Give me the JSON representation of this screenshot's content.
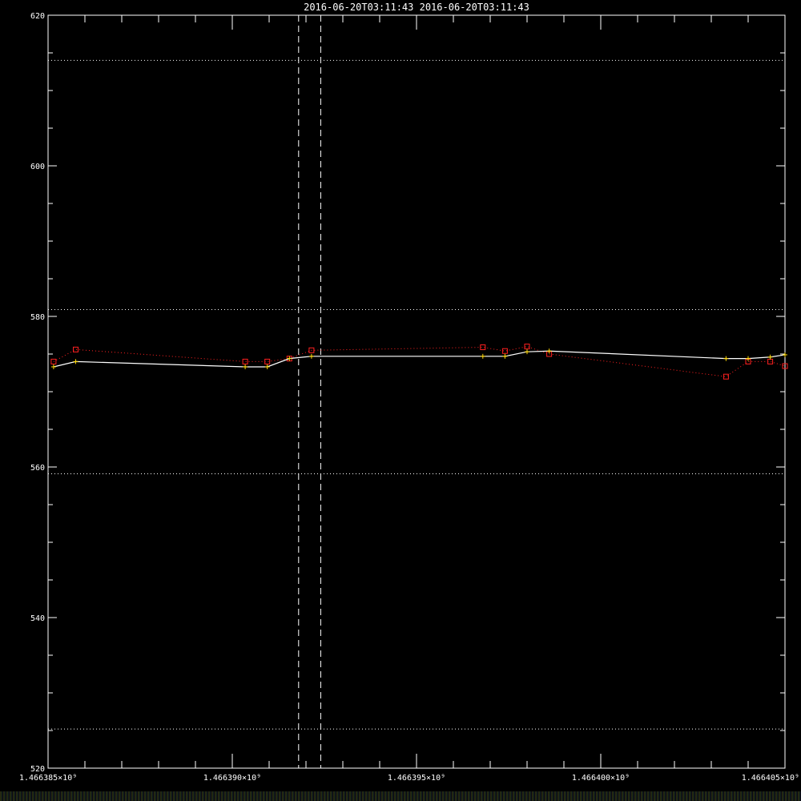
{
  "chart_data": {
    "type": "line",
    "title": "2016-06-20T03:11:43  2016-06-20T03:11:43",
    "xlabel": "",
    "ylabel": "",
    "xlim": [
      1466385000,
      1466405000
    ],
    "ylim": [
      520,
      620
    ],
    "x_ticks": [
      1466385000,
      1466390000,
      1466395000,
      1466400000,
      1466405000
    ],
    "x_tick_labels": [
      "1.466385×10⁹",
      "1.466390×10⁹",
      "1.466395×10⁹",
      "1.466400×10⁹",
      "1.466405×10⁹"
    ],
    "y_ticks": [
      520,
      540,
      560,
      580,
      600,
      620
    ],
    "y_tick_labels": [
      "520",
      "540",
      "560",
      "580",
      "600",
      "620"
    ],
    "vertical_dashed_lines": [
      1466391800,
      1466392400
    ],
    "horizontal_dotted_lines": [
      525.2,
      559.1,
      580.9,
      614.0
    ],
    "series": [
      {
        "style": "solid-white-with-yellow-plus-markers",
        "color": "#ffffff",
        "marker_color": "#ffd700",
        "x": [
          1466385150,
          1466385750,
          1466390350,
          1466390950,
          1466391550,
          1466392150,
          1466396800,
          1466397400,
          1466398000,
          1466398600,
          1466403400,
          1466404000,
          1466404600,
          1466405000
        ],
        "y": [
          573.3,
          574.0,
          573.3,
          573.3,
          574.4,
          574.7,
          574.7,
          574.7,
          575.3,
          575.4,
          574.4,
          574.4,
          574.6,
          574.9
        ]
      },
      {
        "style": "dotted-red-with-square-markers",
        "color": "#ff2020",
        "marker": "square",
        "x": [
          1466385150,
          1466385750,
          1466390350,
          1466390950,
          1466391550,
          1466392150,
          1466396800,
          1466397400,
          1466398000,
          1466398600,
          1466403400,
          1466404000,
          1466404600,
          1466405000
        ],
        "y": [
          574.0,
          575.6,
          574.0,
          574.0,
          574.4,
          575.5,
          575.9,
          575.4,
          576.0,
          575.0,
          572.0,
          574.0,
          574.0,
          573.4
        ]
      }
    ],
    "grid": false,
    "legend": "none"
  },
  "colors": {
    "background": "#000000",
    "axes": "#ffffff",
    "series_main": "#ffffff",
    "series_marker": "#ffd700",
    "series_alt": "#ff2020"
  }
}
